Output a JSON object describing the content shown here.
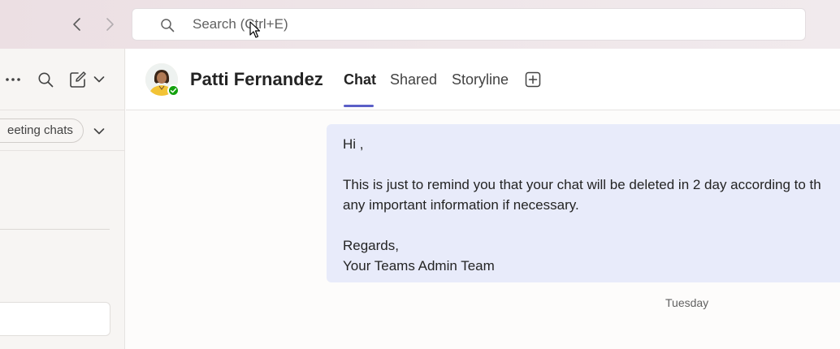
{
  "topbar": {
    "back_icon": "chevron-left-icon",
    "forward_icon": "chevron-right-icon",
    "search": {
      "placeholder": "Search (Ctrl+E)",
      "value": ""
    }
  },
  "left_panel": {
    "filter_pill": "eeting chats",
    "icons": [
      "more-icon",
      "search-icon",
      "compose-icon",
      "chevron-down-icon"
    ]
  },
  "chat_header": {
    "contact_name": "Patti Fernandez",
    "presence": "available",
    "tabs": [
      {
        "label": "Chat",
        "active": true
      },
      {
        "label": "Shared",
        "active": false
      },
      {
        "label": "Storyline",
        "active": false
      }
    ]
  },
  "message": {
    "lines": [
      "Hi ,",
      "",
      "This is just to remind you that your chat will be deleted in 2 day according to th",
      "any important information if necessary.",
      "",
      "Regards,",
      "Your Teams Admin Team"
    ]
  },
  "date_separator": "Tuesday",
  "colors": {
    "accent": "#5b5fc7",
    "message_bubble": "#e8ebfa",
    "presence_available": "#13a10e"
  }
}
